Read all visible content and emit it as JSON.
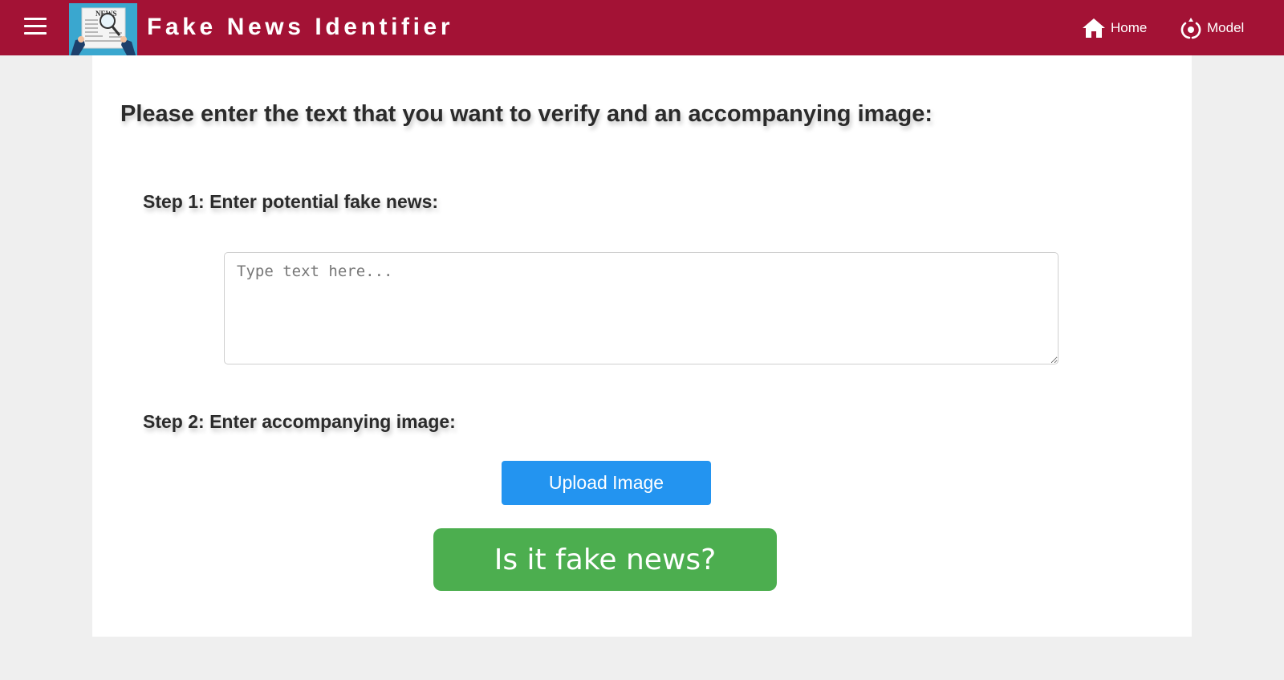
{
  "header": {
    "menu_icon": "hamburger-menu-icon",
    "logo_icon": "newspaper-magnifier-logo",
    "logo_text": "NEWS",
    "title": "Fake News Identifier",
    "nav": [
      {
        "label": "Home",
        "icon": "home-icon"
      },
      {
        "label": "Model",
        "icon": "model-icon"
      }
    ]
  },
  "main": {
    "heading": "Please enter the text that you want to verify and an accompanying image:",
    "step1_label": "Step 1: Enter potential fake news:",
    "text_input": {
      "value": "",
      "placeholder": "Type text here..."
    },
    "step2_label": "Step 2: Enter accompanying image:",
    "upload_label": "Upload Image",
    "submit_label": "Is it fake news?"
  },
  "colors": {
    "header_bg": "#a31235",
    "page_bg": "#efefef",
    "upload_button": "#2394f0",
    "submit_button": "#4cae4f"
  }
}
